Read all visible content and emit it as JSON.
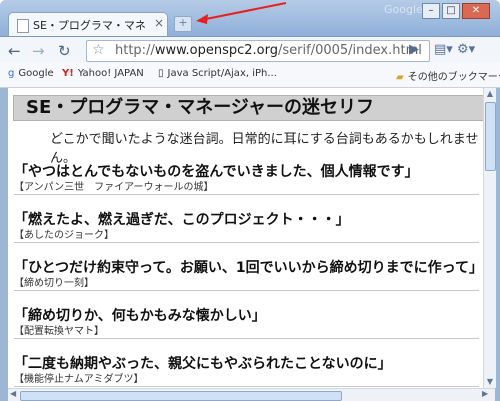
{
  "browser": {
    "brand": "Google",
    "tab_title": "SE・プログラマ・マネージャーの...",
    "url_host": "www.openspc2.org",
    "url_path": "/serif/0005/index.html",
    "url_prefix": "http://",
    "bookmarks": [
      {
        "label": "Google"
      },
      {
        "label": "Yahoo! JAPAN"
      },
      {
        "label": "Java Script/Ajax, iPh..."
      },
      {
        "label": "その他のブックマーク"
      }
    ]
  },
  "page": {
    "title": "SE・プログラマ・マネージャーの迷セリフ",
    "description": "どこかで聞いたような迷台詞。日常的に耳にする台詞もあるかもしれません。",
    "entries": [
      {
        "quote": "「やつはとんでもないものを盗んでいきました、個人情報です」",
        "source": "【アンパン三世　ファイアーウォールの城】"
      },
      {
        "quote": "「燃えたよ、燃え過ぎだ、このプロジェクト・・・」",
        "source": "【あしたのジョーク】"
      },
      {
        "quote": "「ひとつだけ約束守って。お願い、1回でいいから締め切りまでに作って」",
        "source": "【締め切り一刻】"
      },
      {
        "quote": "「締め切りか、何もかもみな懐かしい」",
        "source": "【配置転換ヤマト】"
      },
      {
        "quote": "「二度も納期やぶった、親父にもやぶられたことないのに」",
        "source": "【機能停止ナムアミダブツ】"
      }
    ]
  }
}
